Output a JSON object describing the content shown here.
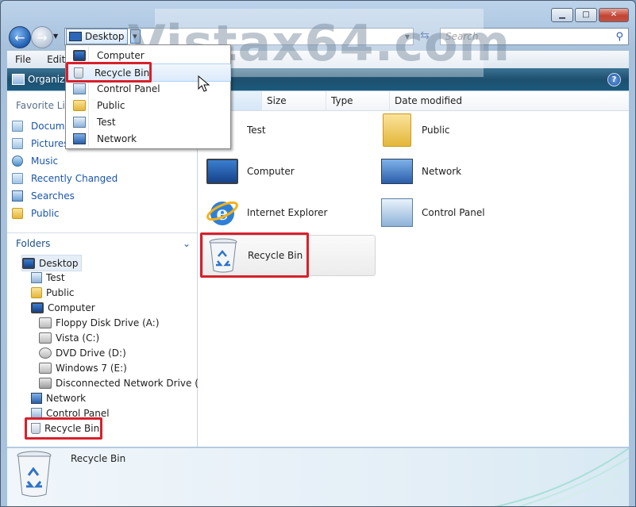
{
  "window": {
    "watermark": "Vistax64.com",
    "caption": {
      "minimize": "▁",
      "maximize": "□",
      "close": "✕"
    }
  },
  "nav": {
    "address_root": "Desktop",
    "search_placeholder": "Search"
  },
  "menu": {
    "file": "File",
    "edit": "Edit"
  },
  "toolbar": {
    "organize": "Organiz",
    "help": "?"
  },
  "left_pane": {
    "favorite_links_title": "Favorite Lin",
    "favorites": [
      {
        "label": "Docume",
        "icon": "documents-icon"
      },
      {
        "label": "Pictures",
        "icon": "pictures-icon"
      },
      {
        "label": "Music",
        "icon": "music-icon"
      },
      {
        "label": "Recently Changed",
        "icon": "recent-icon"
      },
      {
        "label": "Searches",
        "icon": "searches-icon"
      },
      {
        "label": "Public",
        "icon": "folder-icon"
      }
    ],
    "folders_title": "Folders",
    "tree": [
      {
        "label": "Desktop"
      },
      {
        "label": "Test"
      },
      {
        "label": "Public"
      },
      {
        "label": "Computer"
      },
      {
        "label": "Floppy Disk Drive (A:)"
      },
      {
        "label": "Vista (C:)"
      },
      {
        "label": "DVD Drive (D:)"
      },
      {
        "label": "Windows 7 (E:)"
      },
      {
        "label": "Disconnected Network Drive (Z:)"
      },
      {
        "label": "Network"
      },
      {
        "label": "Control Panel"
      },
      {
        "label": "Recycle Bin"
      }
    ]
  },
  "columns": {
    "name": "",
    "size": "Size",
    "type": "Type",
    "date": "Date modified"
  },
  "items": [
    {
      "label": "Test"
    },
    {
      "label": "Public"
    },
    {
      "label": "Computer"
    },
    {
      "label": "Network"
    },
    {
      "label": "Internet Explorer"
    },
    {
      "label": "Control Panel"
    },
    {
      "label": "Recycle Bin"
    }
  ],
  "dropdown": {
    "items": [
      {
        "label": "Computer"
      },
      {
        "label": "Recycle Bin"
      },
      {
        "label": "Control Panel"
      },
      {
        "label": "Public"
      },
      {
        "label": "Test"
      },
      {
        "label": "Network"
      }
    ]
  },
  "details": {
    "title": "Recycle Bin"
  },
  "colors": {
    "highlight": "#d8202b",
    "toolbar": "#1e4f6e",
    "link": "#1a55a8"
  }
}
